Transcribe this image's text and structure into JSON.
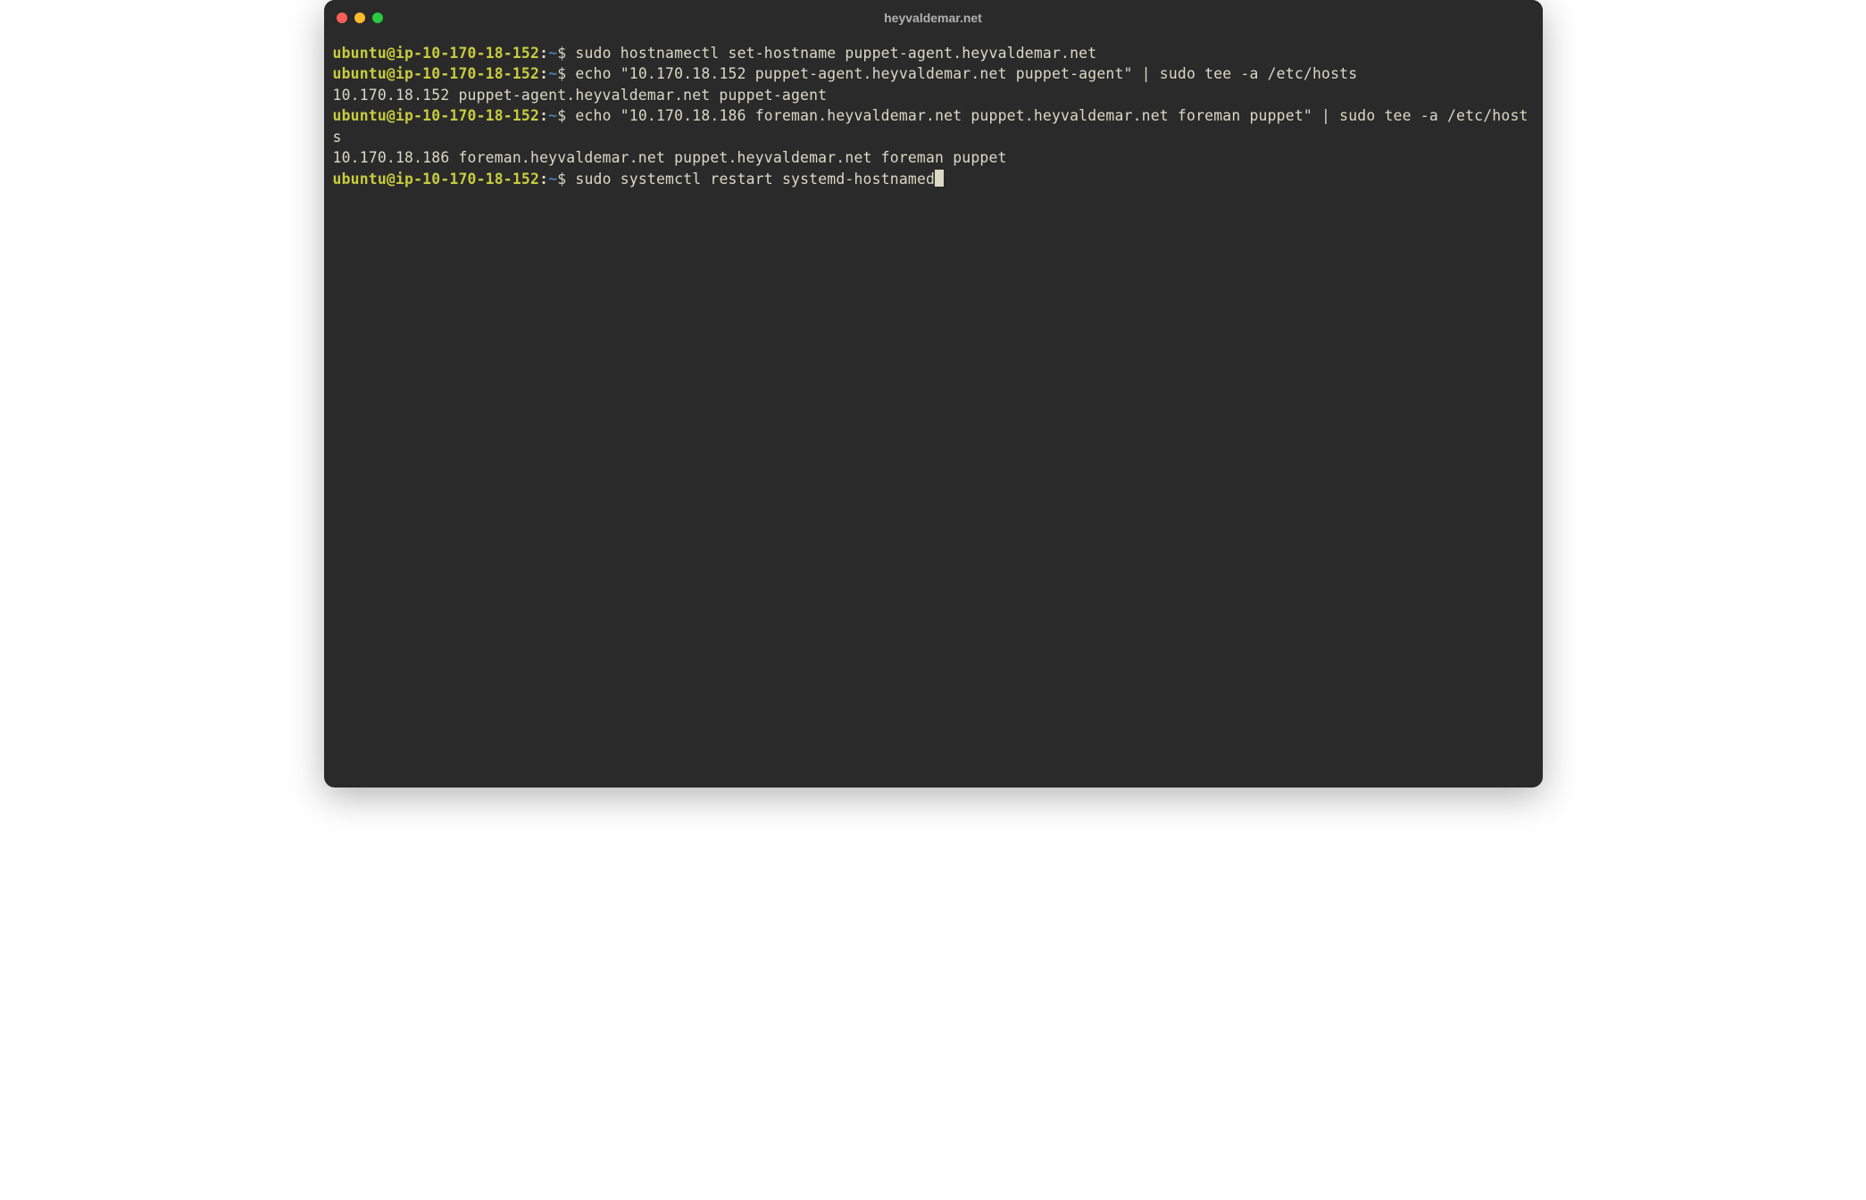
{
  "window": {
    "title": "heyvaldemar.net"
  },
  "traffic_lights": {
    "close_color": "#ff5f57",
    "minimize_color": "#febc2e",
    "zoom_color": "#28c840"
  },
  "prompt": {
    "user_host": "ubuntu@ip-10-170-18-152",
    "colon": ":",
    "path": "~",
    "dollar": "$ "
  },
  "lines": [
    {
      "type": "cmd",
      "text": "sudo hostnamectl set-hostname puppet-agent.heyvaldemar.net"
    },
    {
      "type": "cmd",
      "text": "echo \"10.170.18.152 puppet-agent.heyvaldemar.net puppet-agent\" | sudo tee -a /etc/hosts"
    },
    {
      "type": "out",
      "text": "10.170.18.152 puppet-agent.heyvaldemar.net puppet-agent"
    },
    {
      "type": "cmd",
      "text": "echo \"10.170.18.186 foreman.heyvaldemar.net puppet.heyvaldemar.net foreman puppet\" | sudo tee -a /etc/hosts"
    },
    {
      "type": "out",
      "text": "10.170.18.186 foreman.heyvaldemar.net puppet.heyvaldemar.net foreman puppet"
    },
    {
      "type": "cmd",
      "text": "sudo systemctl restart systemd-hostnamed",
      "cursor": true
    }
  ]
}
